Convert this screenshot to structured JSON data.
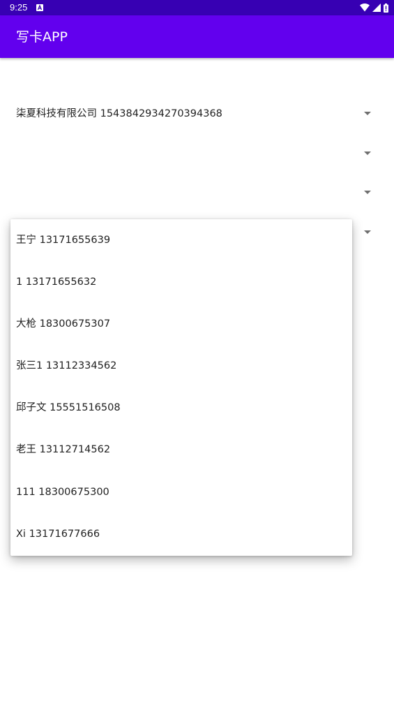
{
  "status_bar": {
    "time": "9:25",
    "notification_icon": "a-box-icon",
    "icons": [
      "wifi-icon",
      "cellular-signal-icon",
      "battery-icon"
    ]
  },
  "app_bar": {
    "title": "写卡APP"
  },
  "spinners": [
    {
      "selected": "柒夏科技有限公司 1543842934270394368"
    },
    {
      "selected": ""
    },
    {
      "selected": ""
    },
    {
      "selected": ""
    }
  ],
  "dropdown": {
    "items": [
      "王宁 13171655639",
      "1 13171655632",
      "大枪 18300675307",
      "张三1 13112334562",
      "邱子文 15551516508",
      "老王 13112714562",
      "111 18300675300",
      "Xi 13171677666"
    ]
  },
  "colors": {
    "status_bar": "#3700b3",
    "app_bar": "#6200ee",
    "text": "#212121"
  }
}
